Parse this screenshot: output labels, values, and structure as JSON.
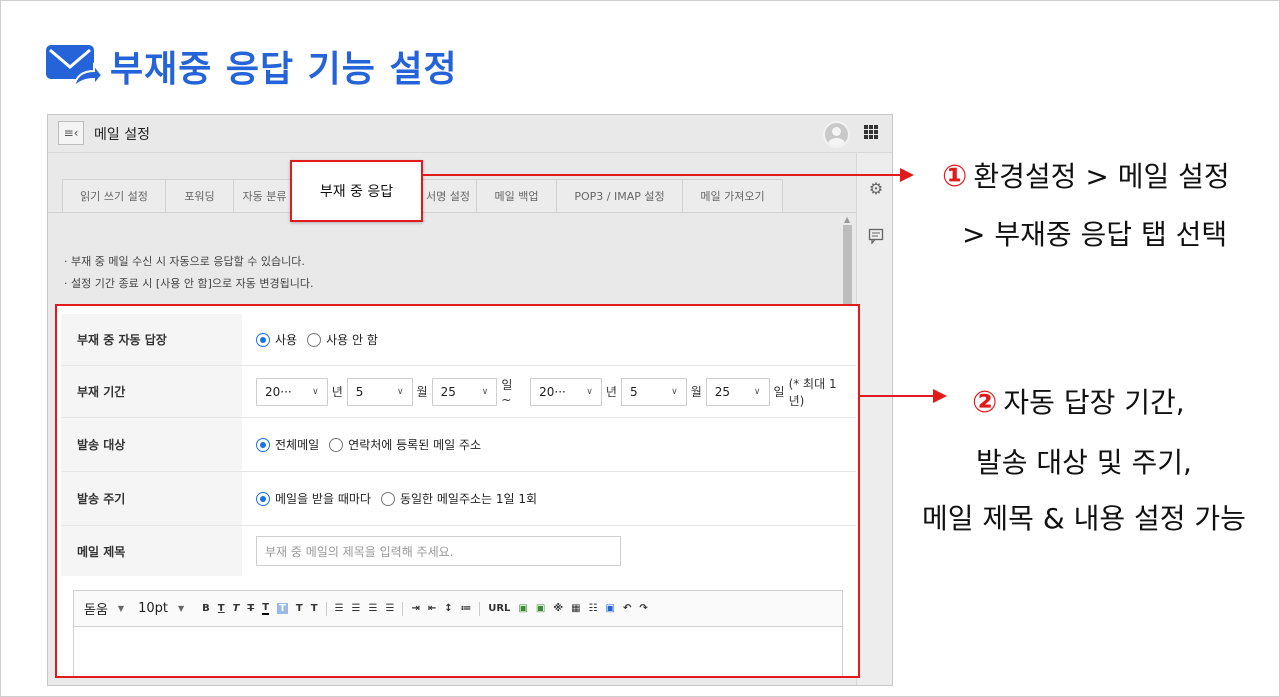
{
  "slide": {
    "title": "부재중 응답 기능 설정",
    "accent_color": "#2563d9",
    "highlight_color": "#e11b1b",
    "title_icon": "mail-forward-icon"
  },
  "panel": {
    "menu_icon": "collapse-menu-icon",
    "title": "메일 설정",
    "avatar": "user-avatar",
    "apps_icon": "apps-grid-icon"
  },
  "tabs": [
    "읽기 쓰기 설정",
    "포워딩",
    "자동 분류",
    "부재 중 응답",
    "서명 설정",
    "메일 백업",
    "POP3 / IMAP 설정",
    "메일 가져오기"
  ],
  "active_tab": "부재 중 응답",
  "notes": [
    "· 부재 중 메일 수신 시 자동으로 응답할 수 있습니다.",
    "· 설정 기간 종료 시 [사용 안 함]으로 자동 변경됩니다."
  ],
  "form": {
    "auto_reply": {
      "label": "부재 중 자동 답장",
      "options": [
        "사용",
        "사용 안 함"
      ],
      "selected": "사용"
    },
    "period": {
      "label": "부재 기간",
      "start_year": "20···",
      "year_unit": "년",
      "start_month": "5",
      "month_unit": "월",
      "start_day": "25",
      "day_unit_start": "일 ~",
      "end_year": "20···",
      "end_month": "5",
      "end_day": "25",
      "day_unit_end": "일",
      "max_note": "(* 최대 1년)"
    },
    "target": {
      "label": "발송 대상",
      "options": [
        "전체메일",
        "연락처에 등록된 메일 주소"
      ],
      "selected": "전체메일"
    },
    "cycle": {
      "label": "발송 주기",
      "options": [
        "메일을 받을 때마다",
        "동일한 메일주소는 1일 1회"
      ],
      "selected": "메일을 받을 때마다"
    },
    "subject": {
      "label": "메일 제목",
      "placeholder": "부재 중 메일의 제목을 입력해 주세요."
    }
  },
  "editor": {
    "font": "돋움",
    "size": "10pt",
    "buttons": [
      "B",
      "T",
      "T",
      "T",
      "T",
      "T",
      "T",
      "T",
      "URL",
      "※",
      "↶",
      "↷"
    ]
  },
  "annotations": {
    "one_num": "①",
    "one_line1": "환경설정 > 메일 설정",
    "one_line2": "> 부재중 응답 탭 선택",
    "two_num": "②",
    "two_line1": "자동 답장 기간,",
    "two_line2": "발송 대상 및 주기,",
    "two_line3": "메일 제목 & 내용 설정 가능"
  }
}
